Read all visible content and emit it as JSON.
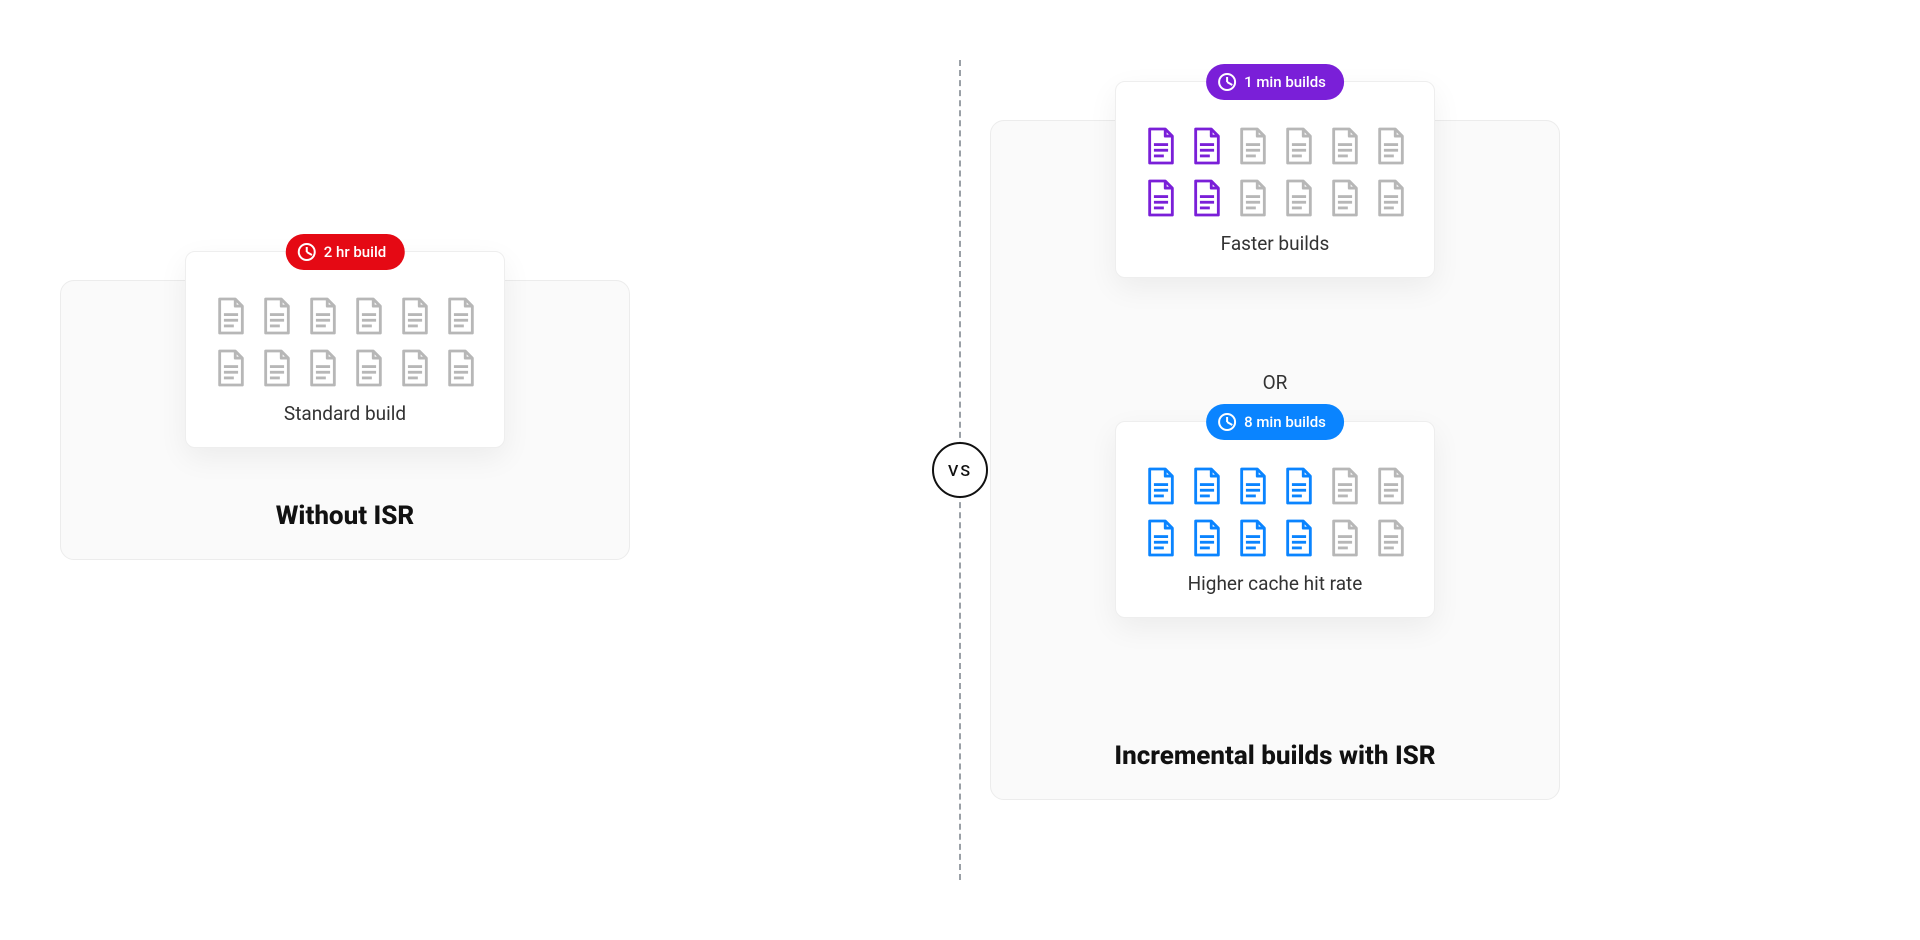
{
  "colors": {
    "red": "#e50914",
    "purple": "#7a1fd8",
    "blue": "#0a84ff",
    "grey": "#b7b7b7"
  },
  "divider": {
    "vs_label": "VS"
  },
  "left": {
    "title": "Without ISR",
    "card": {
      "pill_label": "2 hr build",
      "pill_color": "red",
      "caption": "Standard build",
      "docs_total": 12,
      "docs_highlighted": 0,
      "highlight_color": "grey"
    }
  },
  "right": {
    "title": "Incremental builds with ISR",
    "or_label": "OR",
    "card_a": {
      "pill_label": "1 min builds",
      "pill_color": "purple",
      "caption": "Faster builds",
      "docs_total": 12,
      "docs_highlighted": 4,
      "highlight_color": "purple"
    },
    "card_b": {
      "pill_label": "8 min builds",
      "pill_color": "blue",
      "caption": "Higher cache hit rate",
      "docs_total": 12,
      "docs_highlighted": 8,
      "highlight_color": "blue"
    }
  },
  "chart_data": {
    "type": "table",
    "title": "ISR build-time comparison",
    "series": [
      {
        "name": "Without ISR — Standard build",
        "build_time_min": 120,
        "pages_built": 12,
        "pages_total": 12
      },
      {
        "name": "With ISR — Faster builds",
        "build_time_min": 1,
        "pages_built": 4,
        "pages_total": 12
      },
      {
        "name": "With ISR — Higher cache hit rate",
        "build_time_min": 8,
        "pages_built": 8,
        "pages_total": 12
      }
    ]
  }
}
